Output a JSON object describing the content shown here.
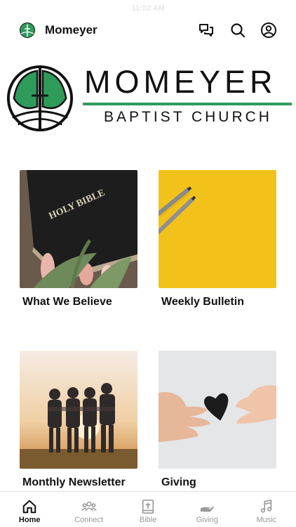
{
  "status_bar": {
    "time": "11:02 AM"
  },
  "header": {
    "title": "Momeyer",
    "icons": [
      "chat-icon",
      "search-icon",
      "account-icon"
    ]
  },
  "banner": {
    "name": "MOMEYER",
    "subtitle": "BAPTIST CHURCH",
    "accent_color": "#2e9b5b"
  },
  "cards": [
    {
      "label": "What We Believe",
      "image": "holy-bible-tulips"
    },
    {
      "label": "Weekly Bulletin",
      "image": "pencils-on-yellow"
    },
    {
      "label": "Monthly Newsletter",
      "image": "friends-at-sunset"
    },
    {
      "label": "Giving",
      "image": "hands-paper-heart"
    }
  ],
  "tabs": [
    {
      "label": "Home",
      "icon": "home-icon",
      "active": true
    },
    {
      "label": "Connect",
      "icon": "people-icon",
      "active": false
    },
    {
      "label": "Bible",
      "icon": "bible-icon",
      "active": false
    },
    {
      "label": "Giving",
      "icon": "giving-hand-icon",
      "active": false
    },
    {
      "label": "Music",
      "icon": "music-note-icon",
      "active": false
    }
  ]
}
